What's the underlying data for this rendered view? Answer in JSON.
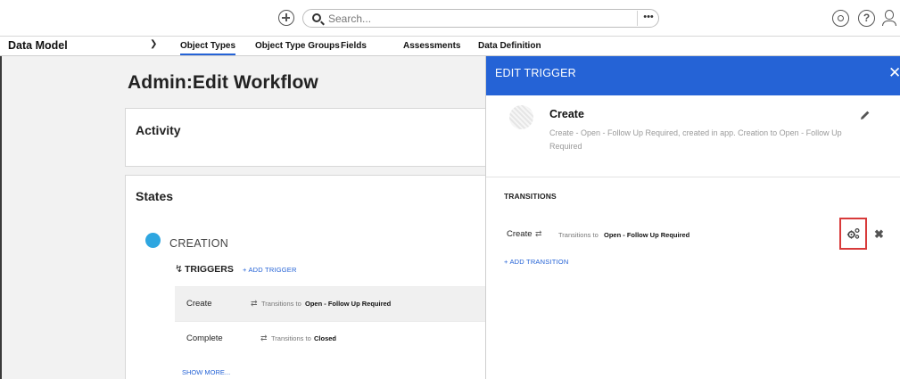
{
  "topbar": {
    "search_placeholder": "Search...",
    "more_label": "•••",
    "icons": [
      "add-circle-icon",
      "search-icon",
      "more-icon",
      "settings-icon",
      "help-icon",
      "user-icon"
    ]
  },
  "nav": {
    "section": "Data Model",
    "tabs": [
      {
        "label": "Object Types",
        "active": true
      },
      {
        "label": "Object Type Groups",
        "active": false
      },
      {
        "label": "Fields",
        "active": false
      },
      {
        "label": "Assessments",
        "active": false
      },
      {
        "label": "Data Definition",
        "active": false
      }
    ]
  },
  "main": {
    "title": "Admin:Edit Workflow",
    "activity_heading": "Activity",
    "states_heading": "States",
    "state_name": "CREATION",
    "triggers_label": "TRIGGERS",
    "add_trigger": "+ ADD TRIGGER",
    "triggers": [
      {
        "name": "Create",
        "transitions_to_label": "Transitions to",
        "destination": "Open - Follow Up Required"
      },
      {
        "name": "Complete",
        "transitions_to_label": "Transitions to",
        "destination": "Closed"
      }
    ],
    "show_more": "SHOW MORE..."
  },
  "panel": {
    "title": "EDIT TRIGGER",
    "trigger_name": "Create",
    "trigger_description": "Create - Open - Follow Up Required, created in app. Creation to Open - Follow Up Required",
    "transitions_label": "TRANSITIONS",
    "transition": {
      "name": "Create",
      "transitions_to_label": "Transitions to",
      "destination": "Open - Follow Up Required"
    },
    "add_transition": "+ ADD TRANSITION"
  },
  "colors": {
    "accent": "#2563d6",
    "state_dot": "#2ea6e0",
    "highlight_border": "#d83a3a"
  }
}
